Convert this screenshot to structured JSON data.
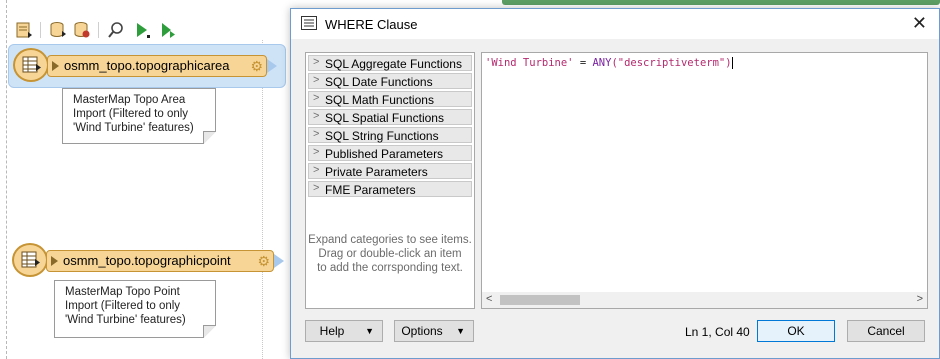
{
  "canvas": {
    "toolbar_icons": [
      "add-reader-icon",
      "database-icon",
      "database-settings-icon",
      "inspect-icon",
      "run-icon",
      "run-partial-icon"
    ],
    "readers": [
      {
        "label": "osmm_topo.topographicarea",
        "selected": true
      },
      {
        "label": "osmm_topo.topographicpoint",
        "selected": false
      }
    ],
    "notes": [
      {
        "lines": [
          "MasterMap Topo Area",
          "Import (Filtered to only",
          "'Wind Turbine' features)"
        ]
      },
      {
        "lines": [
          "MasterMap Topo Point",
          "Import (Filtered to only",
          "'Wind Turbine' features)"
        ]
      }
    ]
  },
  "dialog": {
    "title": "WHERE Clause",
    "categories": [
      "SQL Aggregate Functions",
      "SQL Date Functions",
      "SQL Math Functions",
      "SQL Spatial Functions",
      "SQL String Functions",
      "Published Parameters",
      "Private Parameters",
      "FME Parameters"
    ],
    "hint_lines": [
      "Expand categories to see items.",
      "Drag or double-click an item",
      "to add the corrsponding text."
    ],
    "expression": {
      "string_literal": "'Wind Turbine'",
      "operator": " = ",
      "function": "ANY",
      "argument": "(\"descriptiveterm\")"
    },
    "help_label": "Help",
    "options_label": "Options",
    "cursor_status": "Ln 1, Col 40",
    "ok_label": "OK",
    "cancel_label": "Cancel"
  }
}
